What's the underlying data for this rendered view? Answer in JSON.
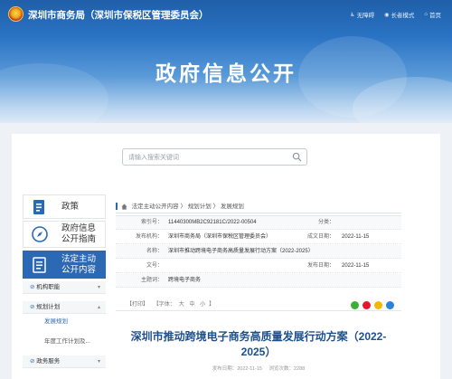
{
  "header": {
    "site_title": "深圳市商务局（深圳市保税区管理委员会）",
    "links": [
      {
        "icon": "accessibility-icon",
        "label": "无障碍"
      },
      {
        "icon": "elderly-icon",
        "label": "长者模式"
      },
      {
        "icon": "home-icon",
        "label": "首页"
      }
    ]
  },
  "banner": {
    "title": "政府信息公开"
  },
  "search": {
    "placeholder": "请输入搜索关键词"
  },
  "sidebar": {
    "items": [
      {
        "label": "政策",
        "icon": "policy-document-icon"
      },
      {
        "label": "政府信息公开指南",
        "label_lines": [
          "政府信息",
          "公开指南"
        ],
        "icon": "compass-icon"
      },
      {
        "label": "法定主动公开内容",
        "label_lines": [
          "法定主动",
          "公开内容"
        ],
        "icon": "document-list-icon",
        "active": true
      }
    ],
    "tree": [
      {
        "label": "机构职能",
        "type": "head",
        "expanded": false
      },
      {
        "label": "规划计划",
        "type": "head",
        "expanded": true
      },
      {
        "label": "发展规划",
        "type": "sub",
        "selected": true
      },
      {
        "label": "年度工作计划及...",
        "type": "sub",
        "selected": false
      },
      {
        "label": "政务服务",
        "type": "head",
        "expanded": false
      }
    ]
  },
  "breadcrumb": {
    "items": [
      "法定主动公开内容",
      "规划计划",
      "发展规划"
    ],
    "separator": "〉"
  },
  "info": {
    "index_label": "索引号：",
    "index_value": "11440300MB2C92181C/2022-00504",
    "category_label": "分类：",
    "category_value": "",
    "publisher_label": "发布机构：",
    "publisher_value": "深圳市商务局（深圳市保税区管理委员会）",
    "created_label": "成文日期：",
    "created_value": "2022-11-15",
    "title_label": "名称：",
    "title_value": "深圳市推动跨境电子商务高质量发展行动方案（2022-2025）",
    "docno_label": "文号：",
    "docno_value": "",
    "pubdate_label": "发布日期：",
    "pubdate_value": "2022-11-15",
    "topic_label": "主题词：",
    "topic_value": "跨境电子商务"
  },
  "toolbar": {
    "print": "【打印】",
    "font_label": "【字体：",
    "font_large": "大",
    "font_medium": "中",
    "font_small": "小",
    "font_close": "】",
    "share_icons": [
      {
        "name": "wechat-share-icon",
        "color": "#3cb034"
      },
      {
        "name": "weibo-share-icon",
        "color": "#e6162d"
      },
      {
        "name": "qzone-share-icon",
        "color": "#f5b800"
      },
      {
        "name": "qq-share-icon",
        "color": "#2b82d9"
      }
    ]
  },
  "article": {
    "title": "深圳市推动跨境电子商务高质量发展行动方案（2022-2025）",
    "title_lines": [
      "深圳市推动跨境电子商务高质量发展行动方案（2022-",
      "2025）"
    ],
    "meta_date": "发布日期：2022-11-15",
    "meta_views": "浏览次数：2288"
  },
  "colors": {
    "brand_blue": "#2c69b4",
    "title_blue": "#1d4f8c",
    "banner_top": "#1f5fa8"
  }
}
